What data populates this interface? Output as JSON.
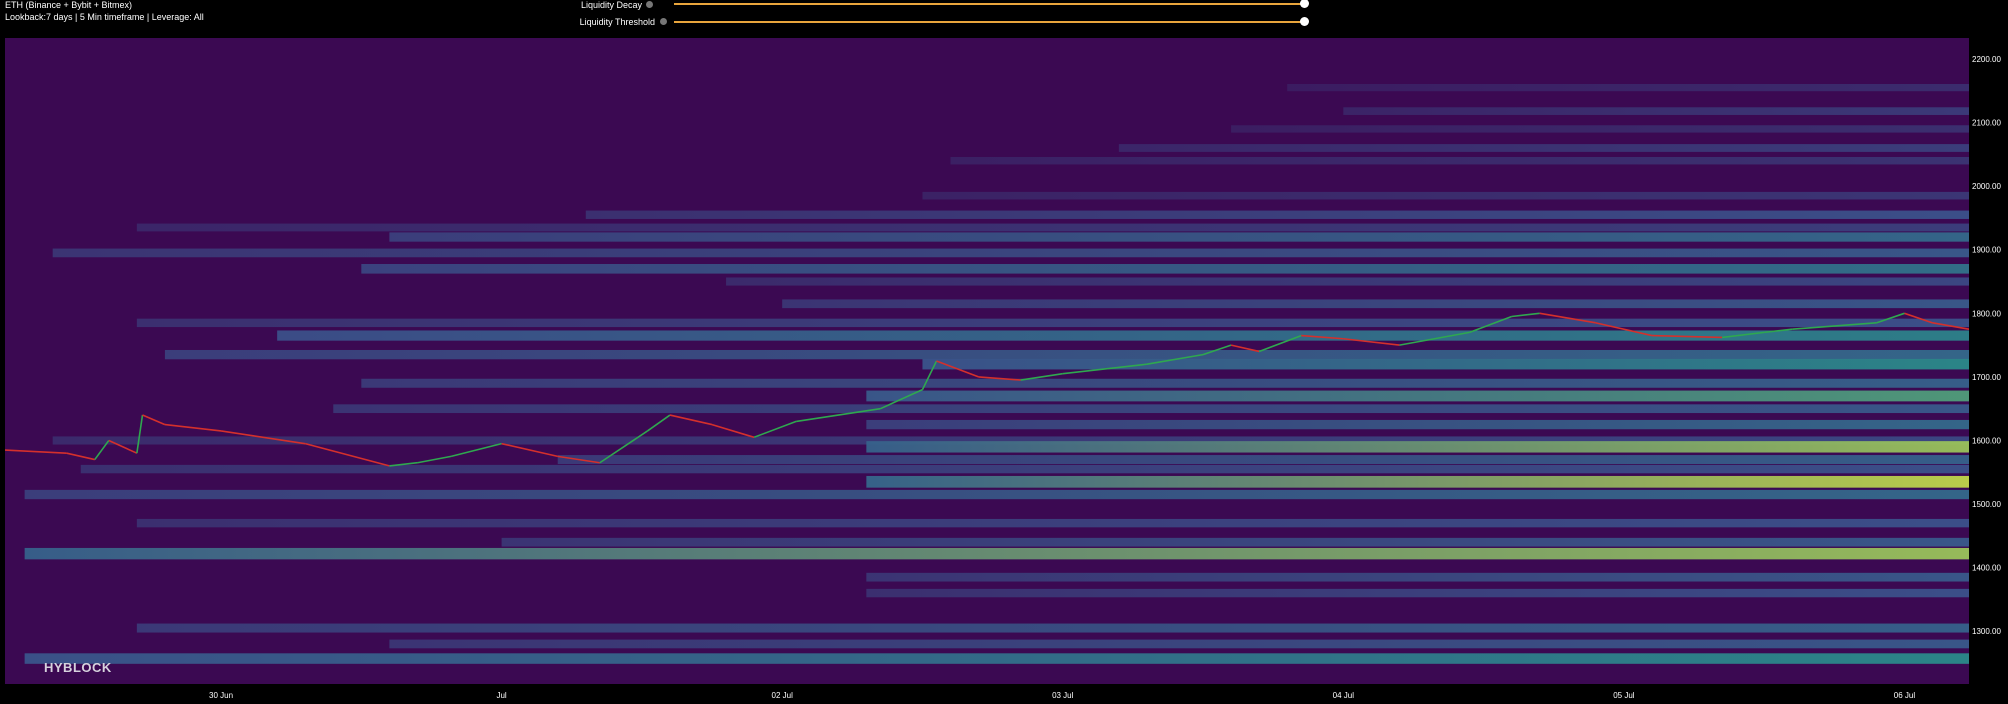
{
  "header": {
    "title": "ETH (Binance + Bybit + Bitmex)",
    "subtitle": "Lookback:7 days | 5 Min timeframe | Leverage: All"
  },
  "controls": [
    {
      "label": "Liquidity Decay",
      "value": 1.0
    },
    {
      "label": "Liquidity Threshold",
      "value": 1.0
    }
  ],
  "watermark": "HYBLOCK",
  "colors": {
    "background": "#000000",
    "heatmap_low": "#3b0952",
    "heatmap_mid": "#2a8b8a",
    "heatmap_high": "#e6e93a",
    "price_up": "#2fa84f",
    "price_down": "#d4302c",
    "slider": "#e8a53c"
  },
  "chart_data": {
    "type": "heatmap",
    "title": "",
    "xlabel": "",
    "ylabel": "",
    "x_ticks": [
      {
        "label": "30 Jun",
        "t": 1.0
      },
      {
        "label": "Jul",
        "t": 2.0
      },
      {
        "label": "02 Jul",
        "t": 3.0
      },
      {
        "label": "03 Jul",
        "t": 4.0
      },
      {
        "label": "04 Jul",
        "t": 5.0
      },
      {
        "label": "05 Jul",
        "t": 6.0
      },
      {
        "label": "06 Jul",
        "t": 7.0
      }
    ],
    "xlim": [
      0.23,
      7.23
    ],
    "y_ticks": [
      1300,
      1400,
      1500,
      1600,
      1700,
      1800,
      1900,
      2000,
      2100,
      2200
    ],
    "ylim": [
      1217,
      2233
    ],
    "liquidity_levels": [
      {
        "price": 2155,
        "start": 4.8,
        "intensity": 0.2
      },
      {
        "price": 2118,
        "start": 5.0,
        "intensity": 0.28
      },
      {
        "price": 2090,
        "start": 4.6,
        "intensity": 0.22
      },
      {
        "price": 2060,
        "start": 4.2,
        "intensity": 0.3
      },
      {
        "price": 2040,
        "start": 3.6,
        "intensity": 0.24
      },
      {
        "price": 1985,
        "start": 3.5,
        "intensity": 0.26
      },
      {
        "price": 1955,
        "start": 2.3,
        "intensity": 0.4
      },
      {
        "price": 1935,
        "start": 0.7,
        "intensity": 0.3
      },
      {
        "price": 1920,
        "start": 1.6,
        "intensity": 0.55
      },
      {
        "price": 1895,
        "start": 0.4,
        "intensity": 0.45
      },
      {
        "price": 1870,
        "start": 1.5,
        "intensity": 0.6
      },
      {
        "price": 1850,
        "start": 2.8,
        "intensity": 0.35
      },
      {
        "price": 1815,
        "start": 3.0,
        "intensity": 0.45
      },
      {
        "price": 1785,
        "start": 0.7,
        "intensity": 0.4
      },
      {
        "price": 1765,
        "start": 1.2,
        "intensity": 0.7
      },
      {
        "price": 1735,
        "start": 0.8,
        "intensity": 0.55
      },
      {
        "price": 1720,
        "start": 3.5,
        "intensity": 0.75
      },
      {
        "price": 1690,
        "start": 1.5,
        "intensity": 0.5
      },
      {
        "price": 1670,
        "start": 3.3,
        "intensity": 0.8
      },
      {
        "price": 1650,
        "start": 1.4,
        "intensity": 0.45
      },
      {
        "price": 1625,
        "start": 3.3,
        "intensity": 0.55
      },
      {
        "price": 1600,
        "start": 0.4,
        "intensity": 0.35
      },
      {
        "price": 1590,
        "start": 3.3,
        "intensity": 0.9
      },
      {
        "price": 1570,
        "start": 2.2,
        "intensity": 0.5
      },
      {
        "price": 1555,
        "start": 0.5,
        "intensity": 0.4
      },
      {
        "price": 1535,
        "start": 3.3,
        "intensity": 0.95
      },
      {
        "price": 1515,
        "start": 0.3,
        "intensity": 0.55
      },
      {
        "price": 1470,
        "start": 0.7,
        "intensity": 0.4
      },
      {
        "price": 1440,
        "start": 2.0,
        "intensity": 0.45
      },
      {
        "price": 1422,
        "start": 0.3,
        "intensity": 0.9
      },
      {
        "price": 1385,
        "start": 3.3,
        "intensity": 0.45
      },
      {
        "price": 1360,
        "start": 3.3,
        "intensity": 0.4
      },
      {
        "price": 1305,
        "start": 0.7,
        "intensity": 0.5
      },
      {
        "price": 1280,
        "start": 1.6,
        "intensity": 0.45
      },
      {
        "price": 1257,
        "start": 0.3,
        "intensity": 0.75
      }
    ],
    "price_series": {
      "t": [
        0.23,
        0.45,
        0.55,
        0.6,
        0.7,
        0.72,
        0.8,
        1.0,
        1.3,
        1.6,
        1.7,
        1.82,
        2.0,
        2.2,
        2.35,
        2.52,
        2.6,
        2.75,
        2.9,
        3.05,
        3.35,
        3.5,
        3.55,
        3.7,
        3.85,
        4.0,
        4.3,
        4.5,
        4.6,
        4.7,
        4.85,
        5.0,
        5.2,
        5.45,
        5.6,
        5.7,
        5.9,
        6.1,
        6.35,
        6.5,
        6.6,
        6.9,
        7.0,
        7.1,
        7.23
      ],
      "price": [
        1585,
        1580,
        1570,
        1600,
        1580,
        1640,
        1625,
        1615,
        1595,
        1560,
        1565,
        1575,
        1595,
        1575,
        1565,
        1615,
        1640,
        1625,
        1605,
        1630,
        1650,
        1680,
        1725,
        1700,
        1695,
        1705,
        1720,
        1735,
        1750,
        1740,
        1765,
        1760,
        1750,
        1770,
        1795,
        1800,
        1785,
        1765,
        1762,
        1770,
        1775,
        1785,
        1800,
        1785,
        1775
      ]
    }
  }
}
